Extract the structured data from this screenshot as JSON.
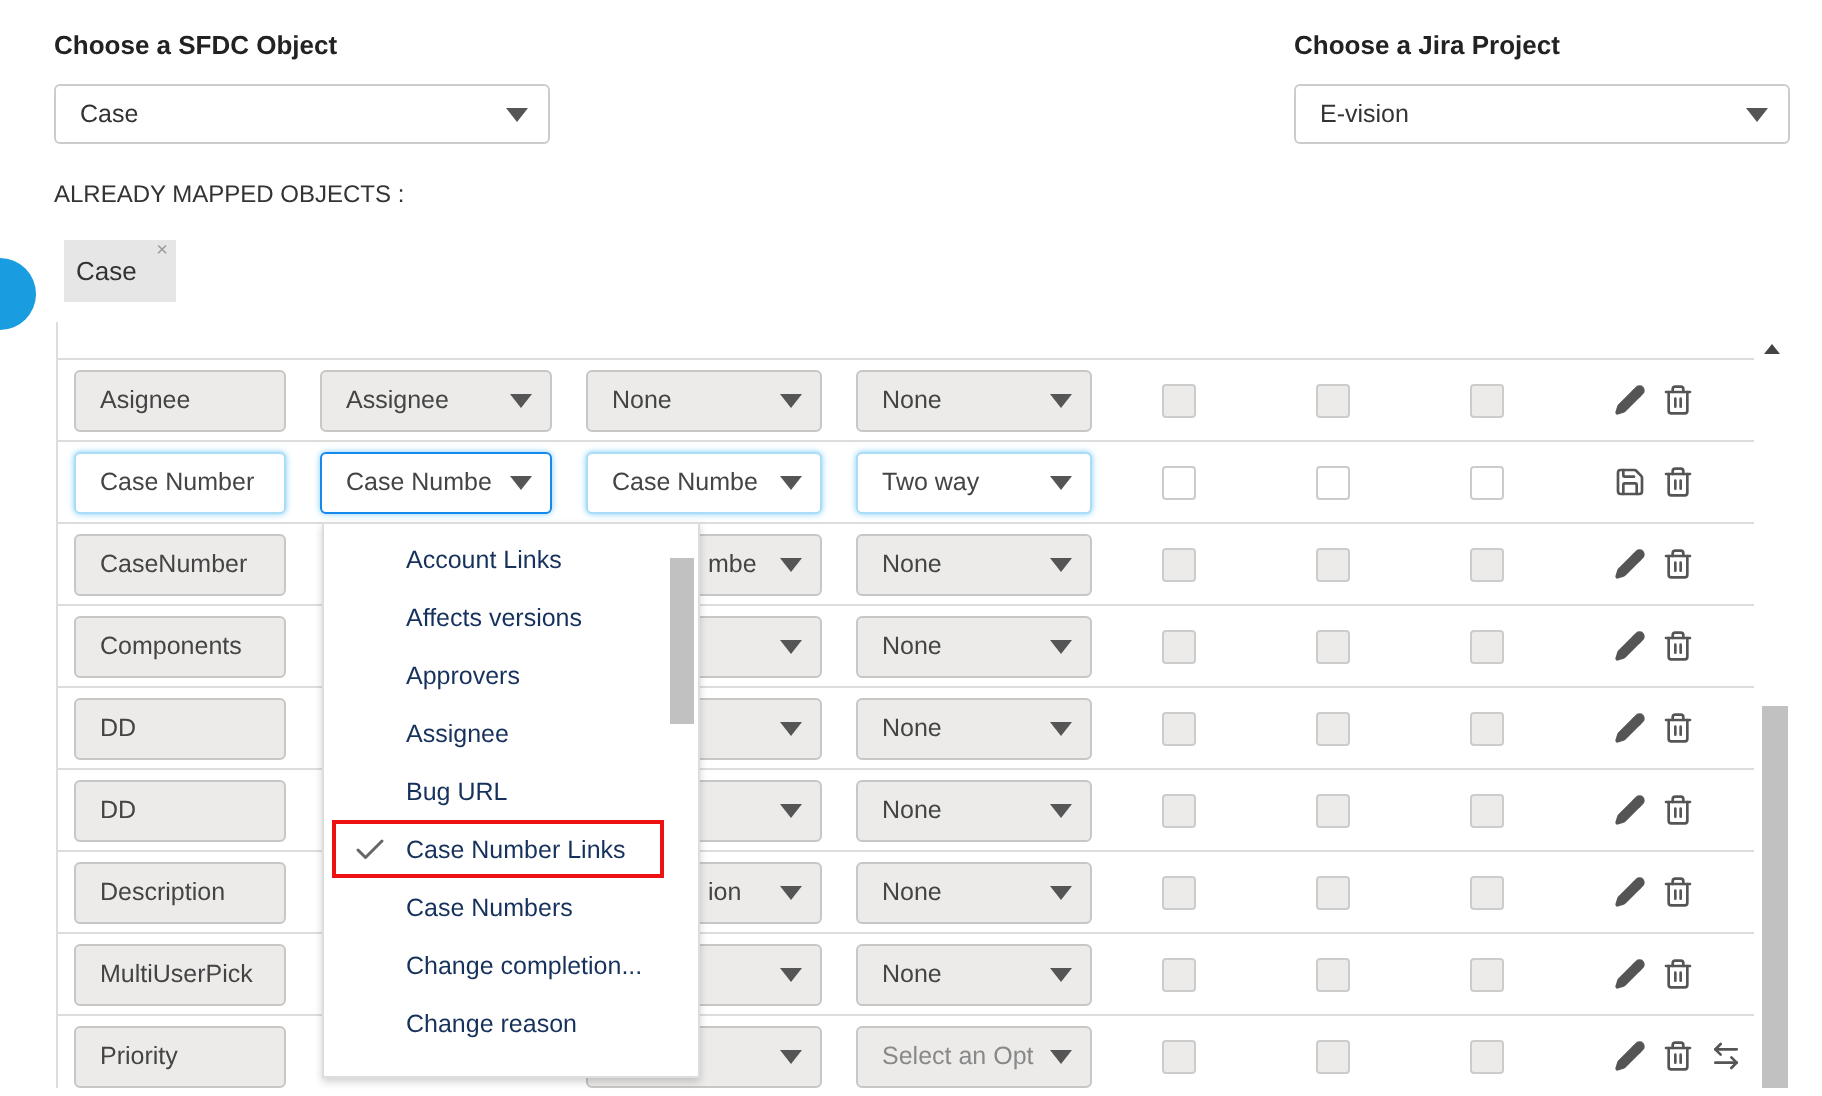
{
  "sfdc": {
    "label": "Choose a SFDC Object",
    "value": "Case"
  },
  "jira": {
    "label": "Choose a Jira Project",
    "value": "E-vision"
  },
  "mapped": {
    "label": "ALREADY MAPPED OBJECTS :",
    "tags": [
      {
        "text": "Case",
        "close": "×"
      }
    ]
  },
  "rows": [
    {
      "editing": false,
      "fields": [
        {
          "kind": "text",
          "value": "Asignee"
        },
        {
          "kind": "select",
          "value": "Assignee"
        },
        {
          "kind": "select",
          "value": "None"
        },
        {
          "kind": "select",
          "value": "None"
        }
      ],
      "checks": [
        {
          "checked": false
        },
        {
          "checked": false
        },
        {
          "checked": false
        }
      ],
      "actions": [
        {
          "kind": "edit"
        },
        {
          "kind": "delete"
        }
      ]
    },
    {
      "editing": true,
      "fields": [
        {
          "kind": "text",
          "value": "Case Number"
        },
        {
          "kind": "select",
          "value": "Case Numbe",
          "focused": true
        },
        {
          "kind": "select",
          "value": "Case Numbe"
        },
        {
          "kind": "select",
          "value": "Two way"
        }
      ],
      "checks": [
        {
          "checked": false
        },
        {
          "checked": false
        },
        {
          "checked": false
        }
      ],
      "actions": [
        {
          "kind": "save"
        },
        {
          "kind": "delete"
        }
      ]
    },
    {
      "editing": false,
      "fields": [
        {
          "kind": "text",
          "value": "CaseNumber"
        },
        {
          "kind": "hidden"
        },
        {
          "kind": "covered_select",
          "value": "mbe"
        },
        {
          "kind": "select",
          "value": "None"
        }
      ],
      "checks": [
        {
          "checked": false
        },
        {
          "checked": false
        },
        {
          "checked": false
        }
      ],
      "actions": [
        {
          "kind": "edit"
        },
        {
          "kind": "delete"
        }
      ]
    },
    {
      "editing": false,
      "fields": [
        {
          "kind": "text",
          "value": "Components"
        },
        {
          "kind": "hidden"
        },
        {
          "kind": "covered_select"
        },
        {
          "kind": "select",
          "value": "None"
        }
      ],
      "checks": [
        {
          "checked": false
        },
        {
          "checked": false
        },
        {
          "checked": false
        }
      ],
      "actions": [
        {
          "kind": "edit"
        },
        {
          "kind": "delete"
        }
      ]
    },
    {
      "editing": false,
      "fields": [
        {
          "kind": "text",
          "value": "DD"
        },
        {
          "kind": "hidden"
        },
        {
          "kind": "covered_select"
        },
        {
          "kind": "select",
          "value": "None"
        }
      ],
      "checks": [
        {
          "checked": false
        },
        {
          "checked": false
        },
        {
          "checked": false
        }
      ],
      "actions": [
        {
          "kind": "edit"
        },
        {
          "kind": "delete"
        }
      ]
    },
    {
      "editing": false,
      "fields": [
        {
          "kind": "text",
          "value": "DD"
        },
        {
          "kind": "hidden"
        },
        {
          "kind": "covered_select"
        },
        {
          "kind": "select",
          "value": "None"
        }
      ],
      "checks": [
        {
          "checked": false
        },
        {
          "checked": false
        },
        {
          "checked": false
        }
      ],
      "actions": [
        {
          "kind": "edit"
        },
        {
          "kind": "delete"
        }
      ]
    },
    {
      "editing": false,
      "fields": [
        {
          "kind": "text",
          "value": "Description"
        },
        {
          "kind": "hidden"
        },
        {
          "kind": "covered_select",
          "value": "ion"
        },
        {
          "kind": "select",
          "value": "None"
        }
      ],
      "checks": [
        {
          "checked": false
        },
        {
          "checked": false
        },
        {
          "checked": false
        }
      ],
      "actions": [
        {
          "kind": "edit"
        },
        {
          "kind": "delete"
        }
      ]
    },
    {
      "editing": false,
      "fields": [
        {
          "kind": "text",
          "value": "MultiUserPick"
        },
        {
          "kind": "hidden"
        },
        {
          "kind": "covered_select"
        },
        {
          "kind": "select",
          "value": "None"
        }
      ],
      "checks": [
        {
          "checked": false
        },
        {
          "checked": false
        },
        {
          "checked": false
        }
      ],
      "actions": [
        {
          "kind": "edit"
        },
        {
          "kind": "delete"
        }
      ]
    },
    {
      "editing": false,
      "fields": [
        {
          "kind": "text",
          "value": "Priority"
        },
        {
          "kind": "hidden"
        },
        {
          "kind": "covered_select"
        },
        {
          "kind": "select",
          "placeholder": "Select an Opt"
        }
      ],
      "checks": [
        {
          "checked": false
        },
        {
          "checked": false
        },
        {
          "checked": false
        }
      ],
      "actions": [
        {
          "kind": "edit"
        },
        {
          "kind": "delete"
        },
        {
          "kind": "swap"
        }
      ]
    }
  ],
  "menu": {
    "items": [
      {
        "label": "Account Links",
        "selected": false
      },
      {
        "label": "Affects versions",
        "selected": false
      },
      {
        "label": "Approvers",
        "selected": false
      },
      {
        "label": "Assignee",
        "selected": false
      },
      {
        "label": "Bug URL",
        "selected": false
      },
      {
        "label": "Case Number Links",
        "selected": true
      },
      {
        "label": "Case Numbers",
        "selected": false
      },
      {
        "label": "Change completion...",
        "selected": false
      },
      {
        "label": "Change reason",
        "selected": false
      }
    ]
  }
}
